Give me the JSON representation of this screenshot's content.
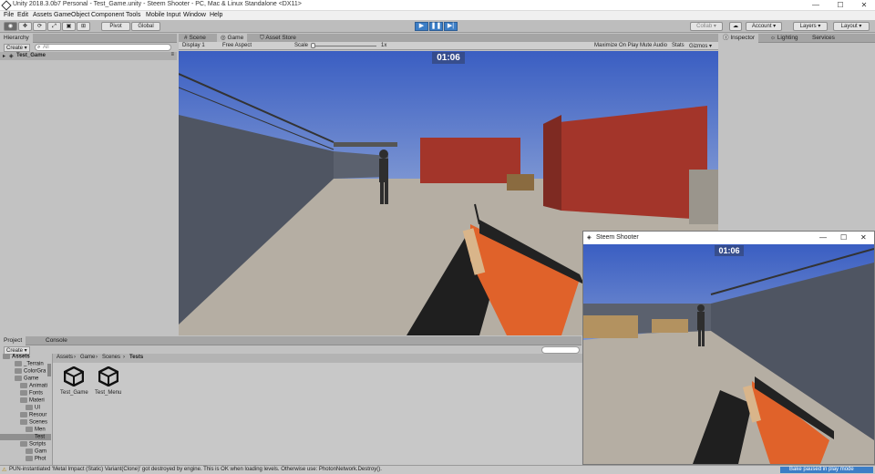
{
  "window": {
    "title": "Unity 2018.3.0b7 Personal - Test_Game.unity - Steem Shooter - PC, Mac & Linux Standalone <DX11>",
    "minimize": "—",
    "maximize": "☐",
    "close": "✕"
  },
  "menu": [
    "File",
    "Edit",
    "Assets",
    "GameObject",
    "Component",
    "Tools",
    "Mobile Input",
    "Window",
    "Help"
  ],
  "toolbar": {
    "pivot": "Pivot",
    "global": "Global",
    "collab": "Collab ▾",
    "account": "Account ▾",
    "layers": "Layers ▾",
    "layout": "Layout ▾"
  },
  "hierarchy": {
    "tab": "Hierarchy",
    "create": "Create ▾",
    "search_placeholder": "All",
    "scene_name": "Test_Game"
  },
  "center_tabs": [
    "Scene",
    "Game",
    "Asset Store"
  ],
  "game_bar": {
    "display": "Display 1",
    "aspect": "Free Aspect",
    "scale_label": "Scale",
    "scale_value": "1x",
    "maximize": "Maximize On Play",
    "mute": "Mute Audio",
    "stats": "Stats",
    "gizmos": "Gizmos ▾"
  },
  "game_view": {
    "timer": "01:06"
  },
  "right_tabs": [
    "Inspector",
    "Lighting",
    "Services"
  ],
  "project": {
    "tabs": [
      "Project",
      "Console"
    ],
    "create": "Create ▾",
    "tree": [
      {
        "label": "Assets",
        "indent": 0,
        "bold": true
      },
      {
        "label": "_Terrain",
        "indent": 2
      },
      {
        "label": "ColorGra",
        "indent": 2
      },
      {
        "label": "Game",
        "indent": 2
      },
      {
        "label": "Animati",
        "indent": 3
      },
      {
        "label": "Fonts",
        "indent": 3
      },
      {
        "label": "Materi",
        "indent": 3
      },
      {
        "label": "UI",
        "indent": 4
      },
      {
        "label": "Resour",
        "indent": 3
      },
      {
        "label": "Scenes",
        "indent": 3
      },
      {
        "label": "Men",
        "indent": 4
      },
      {
        "label": "Test",
        "indent": 4,
        "selected": true
      },
      {
        "label": "Scripts",
        "indent": 3
      },
      {
        "label": "Gam",
        "indent": 4
      },
      {
        "label": "Phot",
        "indent": 4
      }
    ],
    "breadcrumb": [
      "Assets",
      "Game",
      "Scenes",
      "Tests"
    ],
    "files": [
      "Test_Game",
      "Test_Menu"
    ]
  },
  "standalone": {
    "title": "Steem Shooter",
    "timer": "01:06",
    "minimize": "—",
    "maximize": "☐",
    "close": "✕"
  },
  "status": {
    "message": "PUN-instantiated 'Metal Impact (Static) Variant(Clone)' got destroyed by engine. This is OK when loading levels. Otherwise use: PhotonNetwork.Destroy().",
    "right": "Bake paused in play mode"
  },
  "colors": {
    "accent": "#3c7ec6",
    "sky_top": "#3a5ec2",
    "sky_bottom": "#c9d6e6",
    "container": "#a3352a",
    "gun_orange": "#e0622a"
  }
}
